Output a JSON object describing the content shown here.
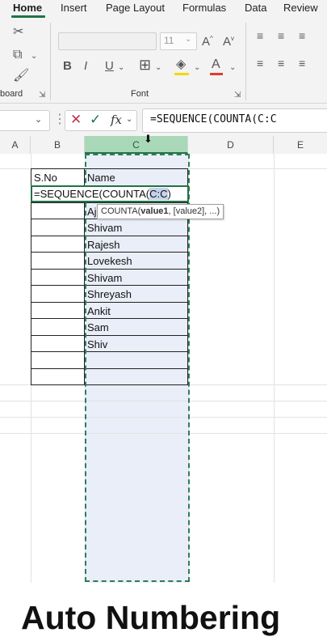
{
  "ribbon": {
    "tabs": [
      {
        "label": "Home",
        "active": true
      },
      {
        "label": "Insert"
      },
      {
        "label": "Page Layout"
      },
      {
        "label": "Formulas"
      },
      {
        "label": "Data"
      },
      {
        "label": "Review"
      }
    ],
    "groups": {
      "clipboard": "board",
      "font": "Font"
    },
    "font_size": "11",
    "accent_color": "#217346"
  },
  "formula_bar": {
    "formula": "=SEQUENCE(COUNTA(C:C",
    "fx_label": "fx"
  },
  "columns": [
    "A",
    "B",
    "C",
    "D",
    "E"
  ],
  "selected_column": "C",
  "sheet": {
    "header_sno": "S.No",
    "header_name": "Name",
    "edit_prefix": "=SEQUENCE(COUNTA(",
    "edit_ref": "C:C",
    "edit_suffix": ")",
    "names": [
      "Aj",
      "Shivam",
      "Rajesh",
      "Lovekesh",
      "Shivam",
      "Shreyash",
      "Ankit",
      "Sam",
      "Shiv"
    ],
    "tooltip": {
      "func": "COUNTA(",
      "arg1": "value1",
      "rest": ", [value2], ...)"
    }
  },
  "caption": "Auto Numbering"
}
